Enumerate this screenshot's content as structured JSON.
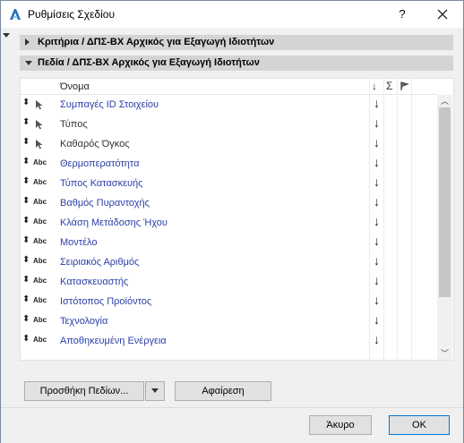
{
  "window": {
    "title": "Ρυθμίσεις Σχεδίου",
    "help": "?",
    "close": "✕"
  },
  "sections": {
    "criteria": "Κριτήρια /  ΔΠΣ-ΒΧ Αρχικός για Εξαγωγή Ιδιοτήτων",
    "fields": "Πεδία /  ΔΠΣ-ΒΧ Αρχικός για Εξαγωγή Ιδιοτήτων"
  },
  "table": {
    "header_name": "Όνομα",
    "header_sort": "↓",
    "header_sum": "Σ",
    "rows": [
      {
        "type": "pointer",
        "label": "Συμπαγές ID Στοιχείου",
        "dark": false
      },
      {
        "type": "pointer",
        "label": "Τύπος",
        "dark": true
      },
      {
        "type": "pointer",
        "label": "Καθαρός Όγκος",
        "dark": true
      },
      {
        "type": "text",
        "label": "Θερμοπερατότητα",
        "dark": false
      },
      {
        "type": "text",
        "label": "Τύπος Κατασκευής",
        "dark": false
      },
      {
        "type": "text",
        "label": "Βαθμός Πυραντοχής",
        "dark": false
      },
      {
        "type": "text",
        "label": "Κλάση Μετάδοσης Ήχου",
        "dark": false
      },
      {
        "type": "text",
        "label": "Μοντέλο",
        "dark": false
      },
      {
        "type": "text",
        "label": "Σειριακός Αριθμός",
        "dark": false
      },
      {
        "type": "text",
        "label": "Κατασκευαστής",
        "dark": false
      },
      {
        "type": "text",
        "label": "Ιστότοπος Προϊόντος",
        "dark": false
      },
      {
        "type": "text",
        "label": "Τεχνολογία",
        "dark": false
      },
      {
        "type": "text",
        "label": "Αποθηκευμένη Ενέργεια",
        "dark": false
      }
    ],
    "row_arrow": "↓",
    "abc_tag": "Abc"
  },
  "buttons": {
    "add_fields": "Προσθήκη Πεδίων...",
    "remove": "Αφαίρεση",
    "cancel": "Άκυρο",
    "ok": "OK"
  },
  "colors": {
    "link_text": "#2b3fa8",
    "section_bg": "#d4d4d4",
    "primary_border": "#0078d7"
  }
}
